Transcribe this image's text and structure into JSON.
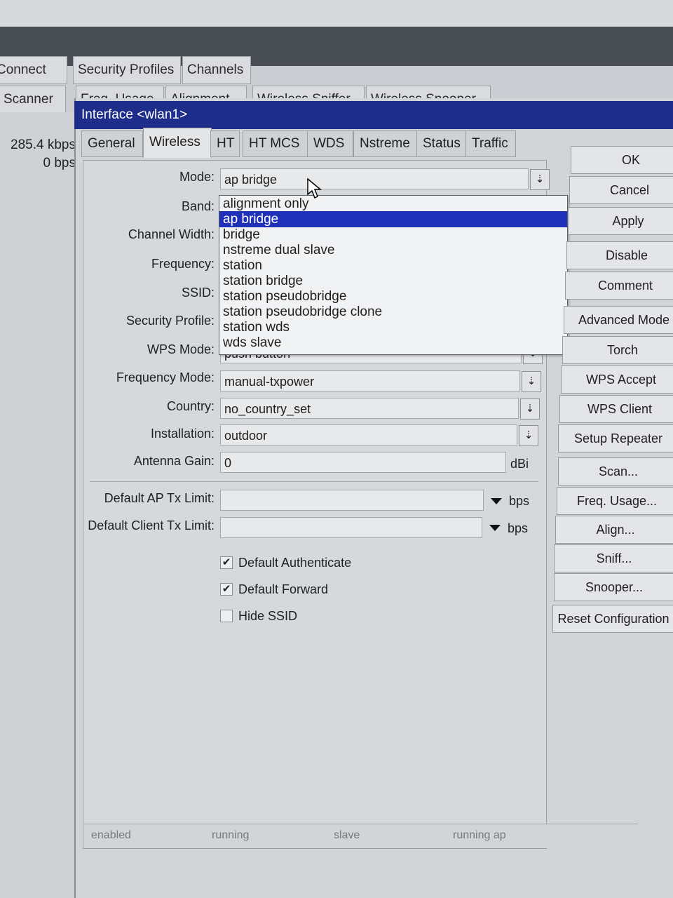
{
  "background_tabs": {
    "row1": [
      "Connect List",
      "Security Profiles",
      "Channels"
    ],
    "row2": [
      "Scanner",
      "Freq. Usage",
      "Alignment",
      "Wireless Sniffer",
      "Wireless Snooper"
    ]
  },
  "left_rates": {
    "tx": "285.4 kbps",
    "rx": "0 bps"
  },
  "dialog": {
    "title": "Interface <wlan1>",
    "tabs": [
      "General",
      "Wireless",
      "HT",
      "HT MCS",
      "WDS",
      "Nstreme",
      "Status",
      "Traffic"
    ],
    "active_tab": "Wireless"
  },
  "form": {
    "mode": {
      "label": "Mode:",
      "value": "ap bridge"
    },
    "band": {
      "label": "Band:"
    },
    "channel_width": {
      "label": "Channel Width:"
    },
    "frequency": {
      "label": "Frequency:"
    },
    "ssid": {
      "label": "SSID:"
    },
    "security_profile": {
      "label": "Security Profile:"
    },
    "wps_mode": {
      "label": "WPS Mode:",
      "value": "push button"
    },
    "frequency_mode": {
      "label": "Frequency Mode:",
      "value": "manual-txpower"
    },
    "country": {
      "label": "Country:",
      "value": "no_country_set"
    },
    "installation": {
      "label": "Installation:",
      "value": "outdoor"
    },
    "antenna_gain": {
      "label": "Antenna Gain:",
      "value": "0",
      "unit": "dBi"
    },
    "default_ap_tx_limit": {
      "label": "Default AP Tx Limit:",
      "unit": "bps"
    },
    "default_client_tx_limit": {
      "label": "Default Client Tx Limit:",
      "unit": "bps"
    }
  },
  "mode_options": [
    "alignment only",
    "ap bridge",
    "bridge",
    "nstreme dual slave",
    "station",
    "station bridge",
    "station pseudobridge",
    "station pseudobridge clone",
    "station wds",
    "wds slave"
  ],
  "mode_selected": "ap bridge",
  "checkboxes": [
    {
      "label": "Default Authenticate",
      "checked": true
    },
    {
      "label": "Default Forward",
      "checked": true
    },
    {
      "label": "Hide SSID",
      "checked": false
    }
  ],
  "buttons": [
    "OK",
    "Cancel",
    "Apply",
    "Disable",
    "Comment",
    "Advanced Mode",
    "Torch",
    "WPS Accept",
    "WPS Client",
    "Setup Repeater",
    "Scan...",
    "Freq. Usage...",
    "Align...",
    "Sniff...",
    "Snooper...",
    "Reset Configuration"
  ],
  "status_bar": [
    "enabled",
    "running",
    "slave",
    "running ap"
  ],
  "icons": {
    "dropdown": "dropdown-arrow-icon",
    "check": "checkmark-icon",
    "cursor": "mouse-pointer-icon"
  }
}
